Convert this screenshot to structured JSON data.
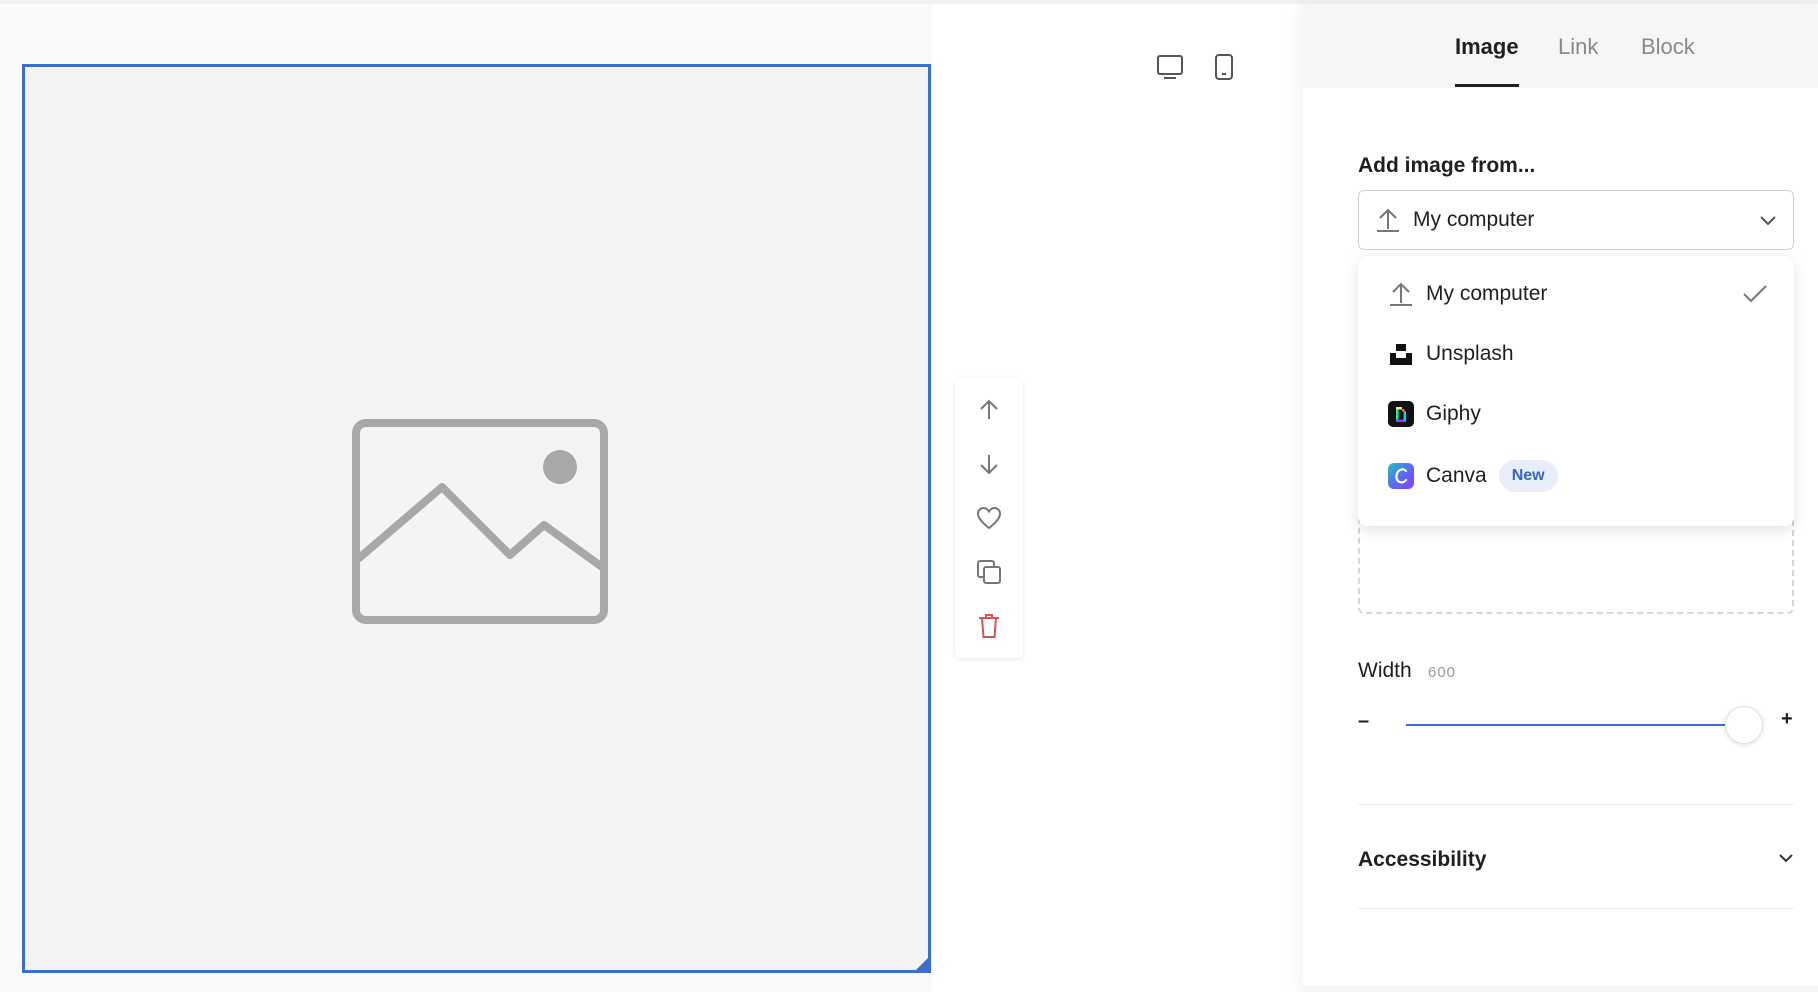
{
  "panel": {
    "tabs": [
      {
        "label": "Image",
        "active": true
      },
      {
        "label": "Link",
        "active": false
      },
      {
        "label": "Block",
        "active": false
      }
    ],
    "add_image_label": "Add image from...",
    "source_select": {
      "value": "My computer",
      "icon": "upload-icon"
    },
    "source_options": [
      {
        "label": "My computer",
        "icon": "upload-icon",
        "selected": true
      },
      {
        "label": "Unsplash",
        "icon": "unsplash-logo-icon"
      },
      {
        "label": "Giphy",
        "icon": "giphy-logo-icon"
      },
      {
        "label": "Canva",
        "icon": "canva-logo-icon",
        "badge": "New"
      }
    ],
    "width": {
      "label": "Width",
      "value": "600",
      "minus": "–",
      "plus": "+",
      "level": 0.94
    },
    "accessibility_label": "Accessibility"
  },
  "block_toolbar": [
    "move-up-icon",
    "move-down-icon",
    "favorite-icon",
    "duplicate-icon",
    "delete-icon"
  ],
  "device_toggles": [
    "desktop-icon",
    "mobile-icon"
  ],
  "colors": {
    "accent": "#3a6fd1",
    "delete": "#d9534f",
    "badge_bg": "#e7eef9",
    "badge_text": "#3466c5"
  }
}
